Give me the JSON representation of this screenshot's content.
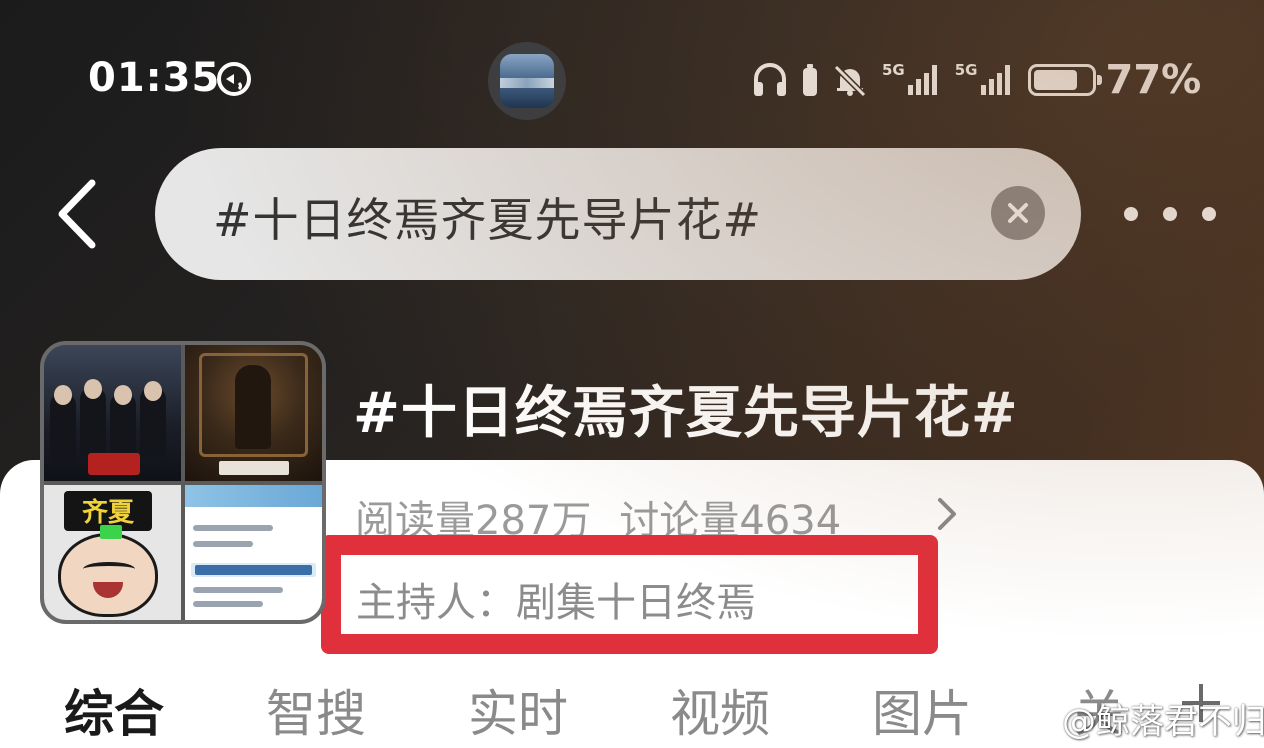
{
  "status_bar": {
    "time": "01:35",
    "network_1": "5G",
    "network_2": "5G",
    "battery_level": 0.77,
    "battery_text": "77%",
    "icons": [
      "sync-icon",
      "headphones-icon",
      "battery-small-icon",
      "mute-bell-icon",
      "signal-icon",
      "signal-icon",
      "battery-icon"
    ]
  },
  "search": {
    "query": "#十日终焉齐夏先导片花#",
    "back_icon": "chevron-left-icon",
    "clear_icon": "close-icon",
    "more_icon": "more-dots-icon"
  },
  "topic": {
    "title": "#十日终焉齐夏先导片花#",
    "reads": "阅读量287万",
    "discussions": "讨论量4634",
    "host": "主持人：剧集十日终焉",
    "thumbnail_sign_text": "齐夏"
  },
  "tabs": [
    {
      "label": "综合",
      "active": true
    },
    {
      "label": "智搜",
      "active": false
    },
    {
      "label": "实时",
      "active": false
    },
    {
      "label": "视频",
      "active": false
    },
    {
      "label": "图片",
      "active": false
    },
    {
      "label": "关",
      "active": false
    }
  ],
  "watermark": {
    "text": "@鲸落君不归"
  },
  "colors": {
    "highlight_box": "#e0303c",
    "search_bg": "#e6e6e6",
    "active_tab": "#1a1a1a",
    "inactive_tab": "#8a8a8a"
  }
}
